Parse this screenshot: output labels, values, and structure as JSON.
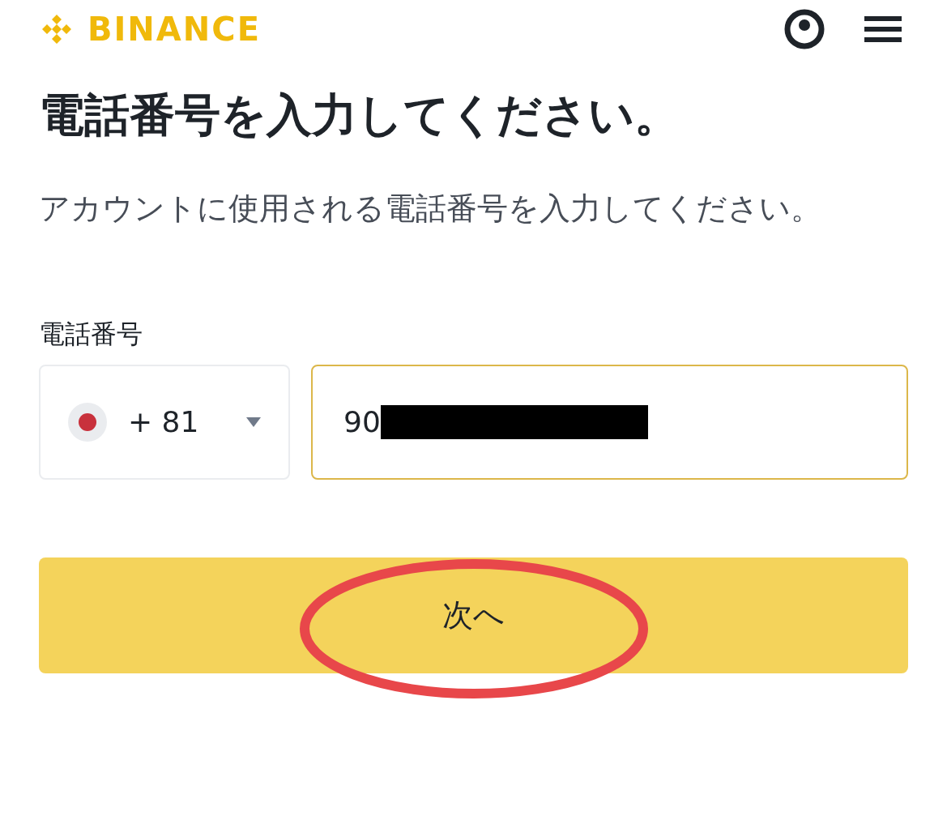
{
  "header": {
    "logo_text": "BINANCE"
  },
  "title": "電話番号を入力してください。",
  "subtitle": "アカウントに使用される電話番号を入力してください。",
  "phone": {
    "label": "電話番号",
    "country_code": "+ 81",
    "value": "90",
    "redacted": true,
    "focused": true
  },
  "button": {
    "label": "次へ",
    "circled": true
  }
}
